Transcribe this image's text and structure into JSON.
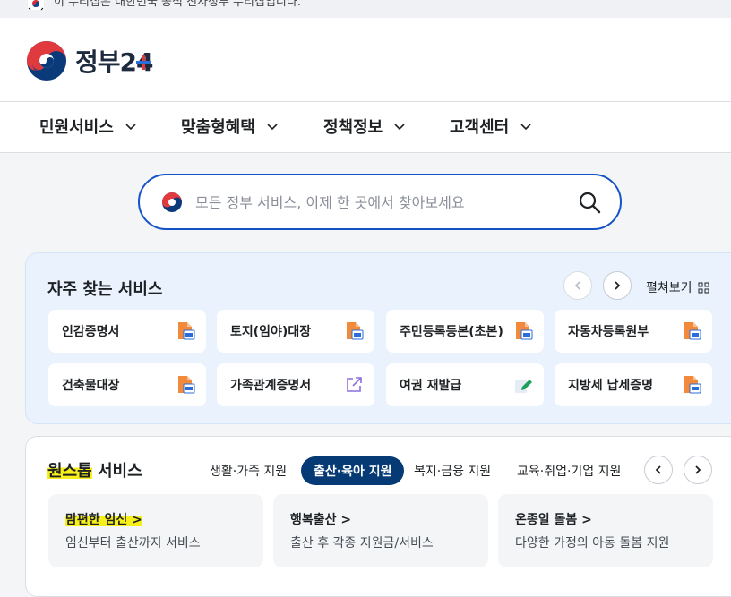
{
  "top_notice": {
    "text": "이 누리집은 대한민국 공식 전자정부 누리집입니다."
  },
  "logo": {
    "text": "정부24"
  },
  "gnb": [
    {
      "label": "민원서비스"
    },
    {
      "label": "맞춤형혜택"
    },
    {
      "label": "정책정보"
    },
    {
      "label": "고객센터"
    }
  ],
  "search": {
    "placeholder": "모든 정부 서비스, 이제 한 곳에서 찾아보세요",
    "value": ""
  },
  "frequent": {
    "title": "자주 찾는 서비스",
    "expand_label": "펼쳐보기",
    "items": [
      {
        "label": "인감증명서",
        "icon": "pc-print-icon"
      },
      {
        "label": "토지(임야)대장",
        "icon": "pc-print-icon"
      },
      {
        "label": "주민등록등본(초본)",
        "icon": "pc-print-icon"
      },
      {
        "label": "자동차등록원부",
        "icon": "pc-print-icon"
      },
      {
        "label": "건축물대장",
        "icon": "pc-print-icon"
      },
      {
        "label": "가족관계증명서",
        "icon": "external-link-icon"
      },
      {
        "label": "여권 재발급",
        "icon": "edit-icon"
      },
      {
        "label": "지방세 납세증명",
        "icon": "pc-print-icon"
      }
    ]
  },
  "onestop": {
    "title_highlight": "원스톱",
    "title_rest": " 서비스",
    "tabs": [
      {
        "label": "생활·가족 지원",
        "active": false
      },
      {
        "label": "출산·육아 지원",
        "active": true
      },
      {
        "label": "복지·금융 지원",
        "active": false
      },
      {
        "label": "교육·취업·기업 지원",
        "active": false
      }
    ],
    "cards": [
      {
        "title": "맘편한 임신 >",
        "desc": "임신부터 출산까지 서비스",
        "highlight": true
      },
      {
        "title": "행복출산 >",
        "desc": "출산 후 각종 지원금/서비스",
        "highlight": false
      },
      {
        "title": "온종일 돌봄 >",
        "desc": "다양한 가정의 아동 돌봄 지원",
        "highlight": false
      }
    ]
  },
  "colors": {
    "primary": "#1452c6",
    "navy": "#063a74",
    "highlight": "#f7ef1a",
    "freq_bg": "#eaf3fd"
  }
}
